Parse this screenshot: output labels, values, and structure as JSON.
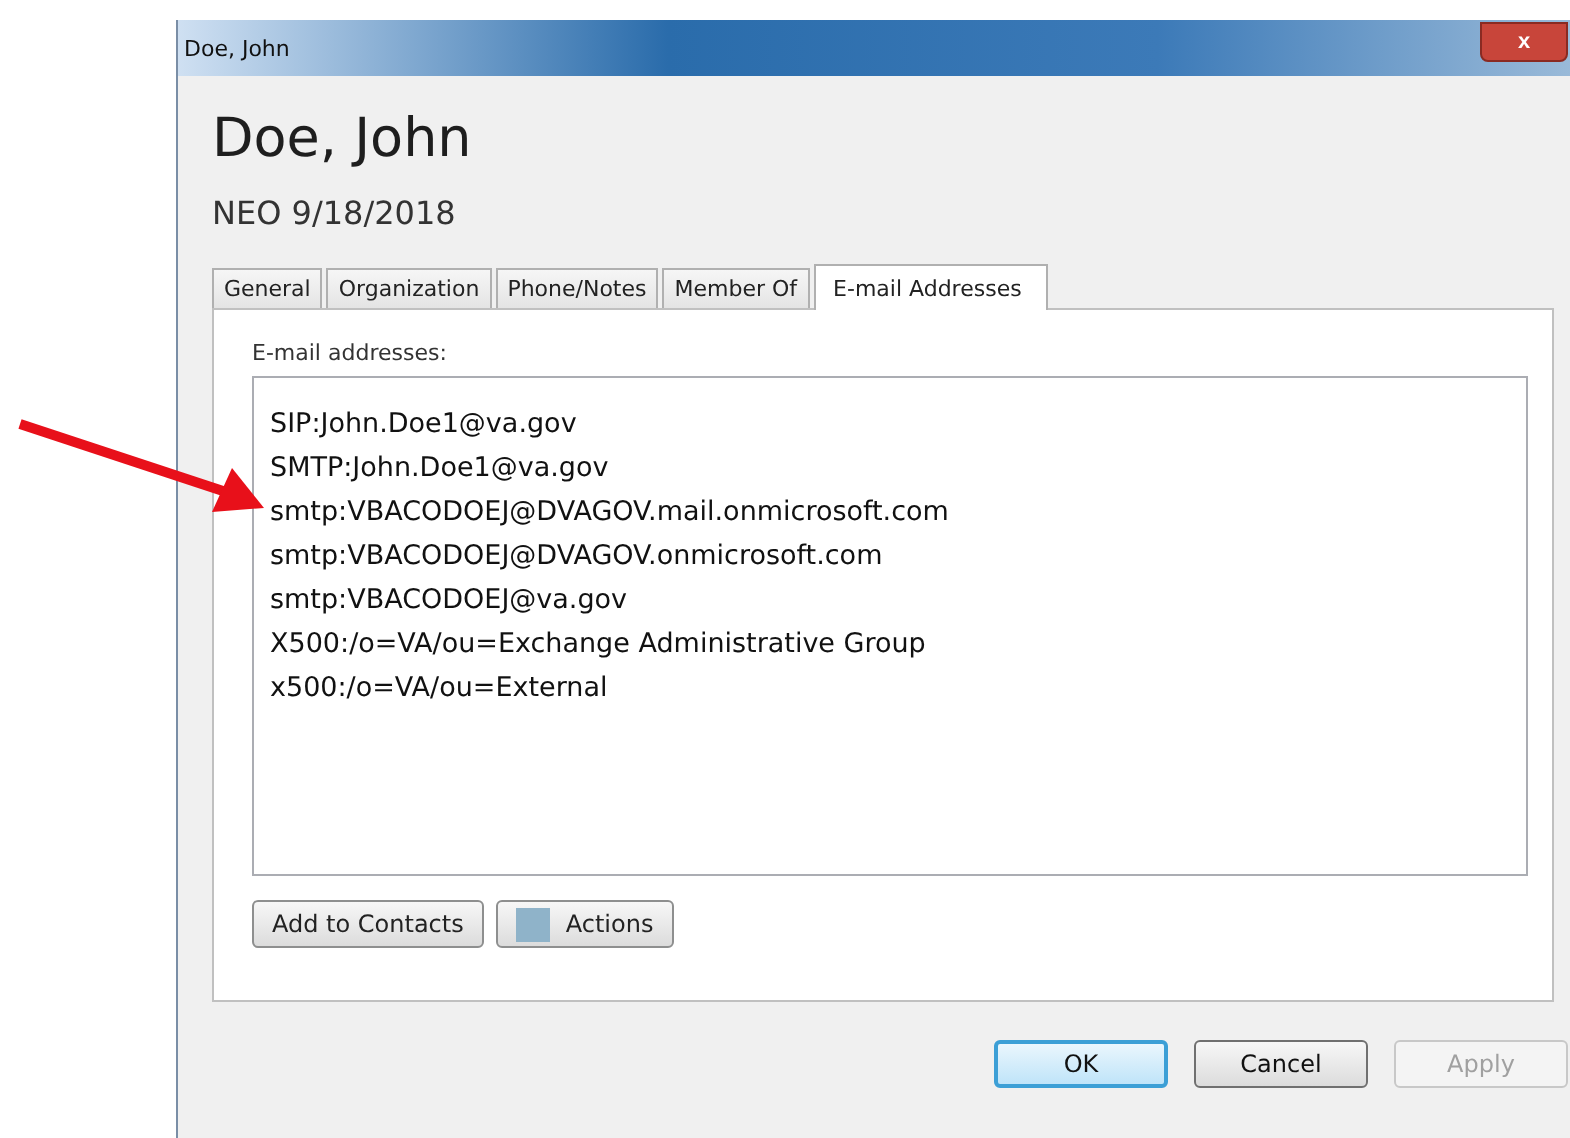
{
  "window": {
    "title": "Doe, John",
    "close": "x"
  },
  "heading": "Doe, John",
  "subheading": "NEO 9/18/2018",
  "tabs": [
    {
      "label": "General",
      "selected": false
    },
    {
      "label": "Organization",
      "selected": false
    },
    {
      "label": "Phone/Notes",
      "selected": false
    },
    {
      "label": "Member Of",
      "selected": false
    },
    {
      "label": "E-mail Addresses",
      "selected": true
    }
  ],
  "addresses_label": "E-mail addresses:",
  "addresses": [
    "SIP:John.Doe1@va.gov",
    "SMTP:John.Doe1@va.gov",
    "smtp:VBACODOEJ@DVAGOV.mail.onmicrosoft.com",
    "smtp:VBACODOEJ@DVAGOV.onmicrosoft.com",
    "smtp:VBACODOEJ@va.gov",
    "X500:/o=VA/ou=Exchange Administrative Group",
    "x500:/o=VA/ou=External"
  ],
  "panel_buttons": [
    {
      "label": "Add to Contacts",
      "kind": "plain"
    },
    {
      "label": "Actions",
      "kind": "icon"
    }
  ],
  "dialog_buttons": [
    {
      "label": "OK",
      "default": true,
      "disabled": false
    },
    {
      "label": "Cancel",
      "default": false,
      "disabled": false
    },
    {
      "label": "Apply",
      "default": false,
      "disabled": true
    }
  ]
}
